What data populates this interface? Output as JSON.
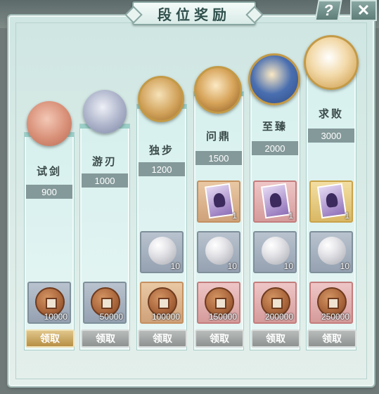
{
  "title": "段位奖励",
  "buttons": {
    "help": "?",
    "close": "✕"
  },
  "ranks": [
    {
      "name": "试剑",
      "points": "900",
      "rewards": [
        {
          "item": "coin-icon",
          "qty": "10000",
          "tier": "gray"
        }
      ],
      "button": "领取",
      "claimable": true
    },
    {
      "name": "游刃",
      "points": "1000",
      "rewards": [
        {
          "item": "coin-icon",
          "qty": "50000",
          "tier": "gray"
        }
      ],
      "button": "领取",
      "claimable": false
    },
    {
      "name": "独步",
      "points": "1200",
      "rewards": [
        {
          "item": "pearl-icon",
          "qty": "10",
          "tier": "gray"
        },
        {
          "item": "coin-icon",
          "qty": "100000",
          "tier": "orange"
        }
      ],
      "button": "领取",
      "claimable": false
    },
    {
      "name": "问鼎",
      "points": "1500",
      "rewards": [
        {
          "item": "card-icon",
          "qty": "1",
          "tier": "orange"
        },
        {
          "item": "pearl-icon",
          "qty": "10",
          "tier": "gray"
        },
        {
          "item": "coin-icon",
          "qty": "150000",
          "tier": "red"
        }
      ],
      "button": "领取",
      "claimable": false
    },
    {
      "name": "至臻",
      "points": "2000",
      "rewards": [
        {
          "item": "card-icon",
          "qty": "1",
          "tier": "red"
        },
        {
          "item": "pearl-icon",
          "qty": "10",
          "tier": "gray"
        },
        {
          "item": "coin-icon",
          "qty": "200000",
          "tier": "red"
        }
      ],
      "button": "领取",
      "claimable": false
    },
    {
      "name": "求败",
      "points": "3000",
      "rewards": [
        {
          "item": "card-icon",
          "qty": "1",
          "tier": "gold"
        },
        {
          "item": "pearl-icon",
          "qty": "10",
          "tier": "gray"
        },
        {
          "item": "coin-icon",
          "qty": "250000",
          "tier": "red"
        }
      ],
      "button": "领取",
      "claimable": false
    }
  ]
}
